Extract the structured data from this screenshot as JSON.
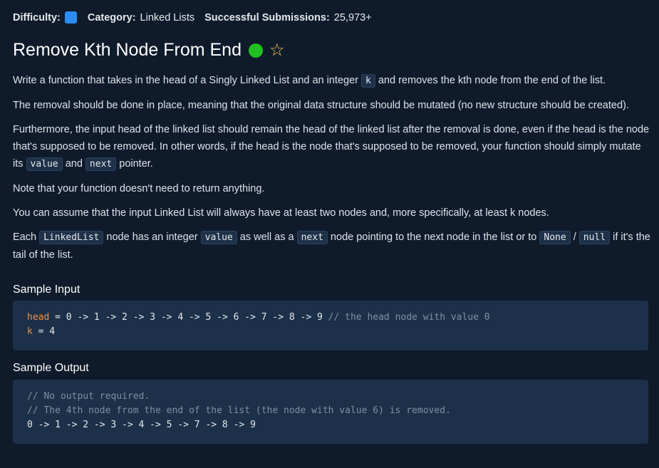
{
  "meta": {
    "difficulty_label": "Difficulty:",
    "category_label": "Category:",
    "category_value": "Linked Lists",
    "submissions_label": "Successful Submissions:",
    "submissions_value": "25,973+"
  },
  "title": "Remove Kth Node From End",
  "colors": {
    "difficulty": "#2b8cf5",
    "completed_dot": "#1fc01f",
    "star": "#f5c451"
  },
  "description": {
    "p1_a": "Write a function that takes in the head of a Singly Linked List and an integer ",
    "p1_code": "k",
    "p1_b": " and removes the kth node from the end of the list.",
    "p2": "The removal should be done in place, meaning that the original data structure should be mutated (no new structure should be created).",
    "p3_a": "Furthermore, the input head of the linked list should remain the head of the linked list after the removal is done, even if the head is the node that's supposed to be removed. In other words, if the head is the node that's supposed to be removed, your function should simply mutate its ",
    "p3_code1": "value",
    "p3_b": " and ",
    "p3_code2": "next",
    "p3_c": " pointer.",
    "p4": "Note that your function doesn't need to return anything.",
    "p5": "You can assume that the input Linked List will always have at least two nodes and, more specifically, at least k nodes.",
    "p6_a": "Each ",
    "p6_code1": "LinkedList",
    "p6_b": " node has an integer ",
    "p6_code2": "value",
    "p6_c": " as well as a ",
    "p6_code3": "next",
    "p6_d": " node pointing to the next node in the list or to ",
    "p6_code4": "None",
    "p6_e": " / ",
    "p6_code5": "null",
    "p6_f": " if it's the tail of the list."
  },
  "sample_input": {
    "heading": "Sample Input",
    "line1_kw": "head",
    "line1_text": " = 0 -> 1 -> 2 -> 3 -> 4 -> 5 -> 6 -> 7 -> 8 -> 9 ",
    "line1_comment": "// the head node with value 0",
    "line2_kw": "k",
    "line2_text": " = 4"
  },
  "sample_output": {
    "heading": "Sample Output",
    "line1": "// No output required.",
    "line2": "// The 4th node from the end of the list (the node with value 6) is removed.",
    "line3": "0 -> 1 -> 2 -> 3 -> 4 -> 5 -> 7 -> 8 -> 9"
  }
}
